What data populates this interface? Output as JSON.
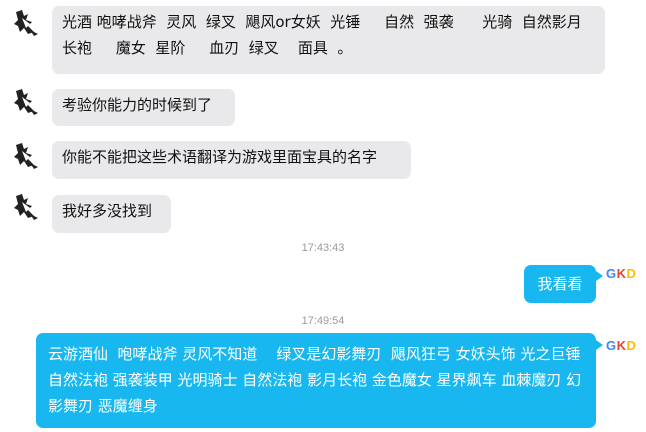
{
  "conversation": {
    "messages": [
      {
        "sender": "left",
        "text": "光酒 咆哮战斧  灵风  绿叉  飓风or女妖  光锤     自然  强袭      光骑  自然影月长袍     魔女  星阶     血刃  绿叉    面具  。"
      },
      {
        "sender": "left",
        "text": "考验你能力的时候到了"
      },
      {
        "sender": "left",
        "text": "你能不能把这些术语翻译为游戏里面宝具的名字"
      },
      {
        "sender": "left",
        "text": "我好多没找到"
      },
      {
        "sender": "right",
        "text": "我看看"
      },
      {
        "sender": "right",
        "text": "云游酒仙  咆哮战斧 灵风不知道    绿叉是幻影舞刃  飓风狂弓 女妖头饰 光之巨锤 自然法袍 强袭装甲 光明骑士 自然法袍 影月长袍 金色魔女 星界飙车 血棘魔刃 幻影舞刃 恶魔缠身"
      }
    ],
    "timestamps": [
      "17:43:43",
      "17:49:54"
    ],
    "self_avatar": {
      "letters": [
        "G",
        "K",
        "D"
      ]
    }
  },
  "colors": {
    "incoming_bubble": "#e9e9eb",
    "outgoing_bubble": "#19b7f0",
    "timestamp": "#9a9a9a"
  }
}
